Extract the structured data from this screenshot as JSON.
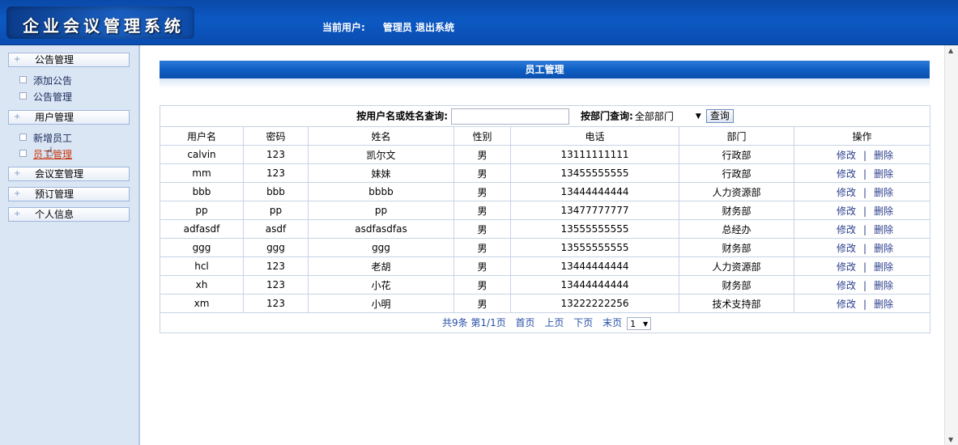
{
  "app": {
    "title": "企业会议管理系统"
  },
  "userbar": {
    "label": "当前用户:",
    "username": "管理员",
    "logout": "退出系统"
  },
  "sidebar": {
    "menus": [
      {
        "label": "公告管理",
        "subs": [
          "添加公告",
          "公告管理"
        ]
      },
      {
        "label": "用户管理",
        "subs": [
          "新增员工",
          "员工管理"
        ]
      },
      {
        "label": "会议室管理"
      },
      {
        "label": "预订管理"
      },
      {
        "label": "个人信息"
      }
    ],
    "active_sub": "员工管理"
  },
  "page": {
    "title": "员工管理"
  },
  "search": {
    "name_label": "按用户名或姓名查询:",
    "name_value": "",
    "dept_label": "按部门查询:",
    "dept_selected": "全部部门",
    "query_button": "查询"
  },
  "table": {
    "columns": [
      "用户名",
      "密码",
      "姓名",
      "性别",
      "电话",
      "部门",
      "操作"
    ],
    "rows": [
      [
        "calvin",
        "123",
        "凯尔文",
        "男",
        "13111111111",
        "行政部"
      ],
      [
        "mm",
        "123",
        "妹妹",
        "男",
        "13455555555",
        "行政部"
      ],
      [
        "bbb",
        "bbb",
        "bbbb",
        "男",
        "13444444444",
        "人力资源部"
      ],
      [
        "pp",
        "pp",
        "pp",
        "男",
        "13477777777",
        "财务部"
      ],
      [
        "adfasdf",
        "asdf",
        "asdfasdfas",
        "男",
        "13555555555",
        "总经办"
      ],
      [
        "ggg",
        "ggg",
        "ggg",
        "男",
        "13555555555",
        "财务部"
      ],
      [
        "hcl",
        "123",
        "老胡",
        "男",
        "13444444444",
        "人力资源部"
      ],
      [
        "xh",
        "123",
        "小花",
        "男",
        "13444444444",
        "财务部"
      ],
      [
        "xm",
        "123",
        "小明",
        "男",
        "13222222256",
        "技术支持部"
      ]
    ],
    "edit_label": "修改",
    "sep": "|",
    "delete_label": "删除"
  },
  "pager": {
    "summary": "共9条 第1/1页",
    "first": "首页",
    "prev": "上页",
    "next": "下页",
    "last": "末页",
    "page_selected": "1"
  }
}
